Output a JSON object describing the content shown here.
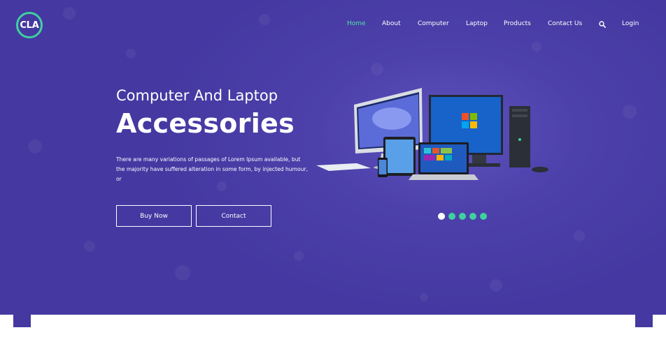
{
  "brand": {
    "logo_text": "CLA",
    "accent": "#3fd0a0",
    "background": "#4538a1"
  },
  "nav": {
    "items": [
      {
        "label": "Home",
        "active": true
      },
      {
        "label": "About"
      },
      {
        "label": "Computer"
      },
      {
        "label": "Laptop"
      },
      {
        "label": "Products"
      },
      {
        "label": "Contact Us"
      }
    ],
    "search_icon": "search-icon",
    "login_label": "Login"
  },
  "hero": {
    "subtitle": "Computer And Laptop",
    "title": "Accessories",
    "description": "There are many variations of passages of Lorem Ipsum available, but the majority have suffered alteration in some form, by injected humour, or",
    "buttons": {
      "buy_label": "Buy Now",
      "contact_label": "Contact"
    },
    "slider": {
      "count": 5,
      "active_index": 0
    }
  }
}
